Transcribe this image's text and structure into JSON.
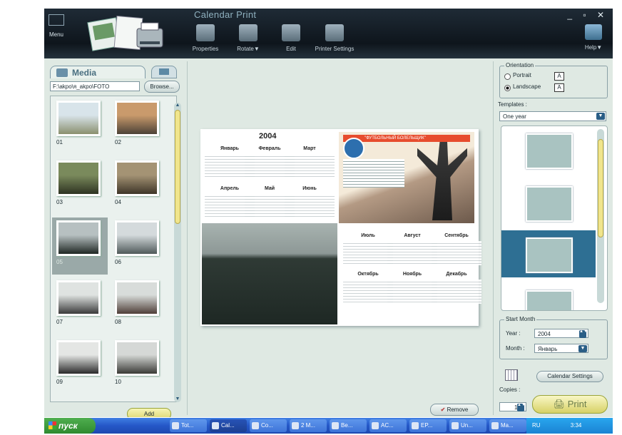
{
  "window": {
    "title": "Calendar Print",
    "menu_label": "Menu",
    "controls": "_ ▫ ✕",
    "toolbar": [
      {
        "label": "Properties",
        "icon": "properties-icon"
      },
      {
        "label": "Rotate▼",
        "icon": "rotate-icon"
      },
      {
        "label": "Edit",
        "icon": "edit-icon"
      },
      {
        "label": "Printer Settings",
        "icon": "printer-settings-icon"
      }
    ],
    "help_label": "Help▼"
  },
  "left_panel": {
    "media_tab": "Media",
    "path": "F:\\akpo\\я_akpo\\FOTO",
    "browse": "Browse...",
    "thumbnails": [
      {
        "num": "01",
        "colors": [
          "#d8e4ea",
          "#8a8f6e"
        ]
      },
      {
        "num": "02",
        "colors": [
          "#c99a6c",
          "#4c4237"
        ]
      },
      {
        "num": "03",
        "colors": [
          "#7a8a5c",
          "#2e3322"
        ]
      },
      {
        "num": "04",
        "colors": [
          "#a49374",
          "#3e3528"
        ]
      },
      {
        "num": "05",
        "colors": [
          "#b7c0c1",
          "#1f2723"
        ],
        "selected": true
      },
      {
        "num": "06",
        "colors": [
          "#d4dadc",
          "#505a5a"
        ]
      },
      {
        "num": "07",
        "colors": [
          "#dfe3e1",
          "#3a3a3a"
        ]
      },
      {
        "num": "08",
        "colors": [
          "#d8dcda",
          "#4f3e38"
        ]
      },
      {
        "num": "09",
        "colors": [
          "#e4e6e4",
          "#2a2a2a"
        ]
      },
      {
        "num": "10",
        "colors": [
          "#d5d8d6",
          "#3a3a36"
        ]
      }
    ],
    "add": "Add"
  },
  "calendar": {
    "year": "2004",
    "months_top": [
      "Январь",
      "Февраль",
      "Март",
      "Апрель",
      "Май",
      "Июнь"
    ],
    "months_bottom": [
      "Июль",
      "Август",
      "Сентябрь",
      "Октябрь",
      "Ноябрь",
      "Декабрь"
    ],
    "photo_header": "\"ФУТБОЛЬНЫЙ БОЛЕЛЬЩИК\"",
    "remove": "Remove"
  },
  "right_panel": {
    "orientation_label": "Orientation",
    "portrait": "Portrait",
    "landscape": "Landscape",
    "orientation_selected": "Landscape",
    "a_glyph": "A",
    "templates_label": "Templates :",
    "template_value": "One year",
    "dropdown_glyph": "▼",
    "start_month_label": "Start Month",
    "year_label": "Year :",
    "year_value": "2004",
    "month_label": "Month :",
    "month_value": "Январь",
    "spin_glyph": "▲▼",
    "calendar_settings": "Calendar Settings",
    "copies_label": "Copies :",
    "copies_value": "1",
    "print": "Print"
  },
  "taskbar": {
    "start": "пуск",
    "tasks": [
      {
        "label": "Tot...",
        "active": false
      },
      {
        "label": "Cal...",
        "active": true
      },
      {
        "label": "Co...",
        "active": false
      },
      {
        "label": "2 M...",
        "active": false
      },
      {
        "label": "Be...",
        "active": false
      },
      {
        "label": "AC...",
        "active": false
      },
      {
        "label": "EP...",
        "active": false
      },
      {
        "label": "Un...",
        "active": false
      },
      {
        "label": "Ma...",
        "active": false
      }
    ],
    "lang": "RU",
    "clock": "3:34"
  },
  "colors": {
    "accent": "#2e6f93",
    "button_yellow": "#f0e58c",
    "window_bg": "#dfe9e3",
    "taskbar": "#2557c7"
  }
}
